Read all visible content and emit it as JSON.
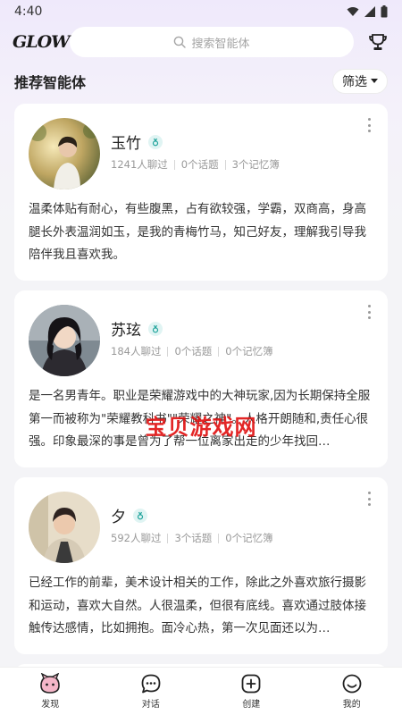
{
  "status_bar": {
    "time": "4:40"
  },
  "header": {
    "logo_text": "GLOW",
    "search_placeholder": "搜索智能体"
  },
  "section": {
    "title": "推荐智能体",
    "filter_label": "筛选"
  },
  "cards": [
    {
      "name": "玉竹",
      "stats": [
        "1241人聊过",
        "0个话题",
        "3个记忆簿"
      ],
      "description": "温柔体贴有耐心，有些腹黑，占有欲较强，学霸，双商高，身高腿长外表温润如玉，是我的青梅竹马，知己好友，理解我引导我陪伴我且喜欢我。"
    },
    {
      "name": "苏玹",
      "stats": [
        "184人聊过",
        "0个话题",
        "0个记忆簿"
      ],
      "description": "是一名男青年。职业是荣耀游戏中的大神玩家,因为长期保持全服第一而被称为\"荣耀教科书\"\"荣耀之神\"。人格开朗随和,责任心很强。印象最深的事是曾为了帮一位离家出走的少年找回…"
    },
    {
      "name": "夕",
      "stats": [
        "592人聊过",
        "3个话题",
        "0个记忆簿"
      ],
      "description": "已经工作的前辈，美术设计相关的工作，除此之外喜欢旅行摄影和运动，喜欢大自然。人很温柔，但很有底线。喜欢通过肢体接触传达感情，比如拥抱。面冷心热，第一次见面还以为…"
    }
  ],
  "watermark": "宝贝游戏网",
  "bottom_nav": [
    {
      "label": "发现",
      "icon": "discover-icon"
    },
    {
      "label": "对话",
      "icon": "chat-icon"
    },
    {
      "label": "创建",
      "icon": "create-icon"
    },
    {
      "label": "我的",
      "icon": "profile-icon"
    }
  ]
}
